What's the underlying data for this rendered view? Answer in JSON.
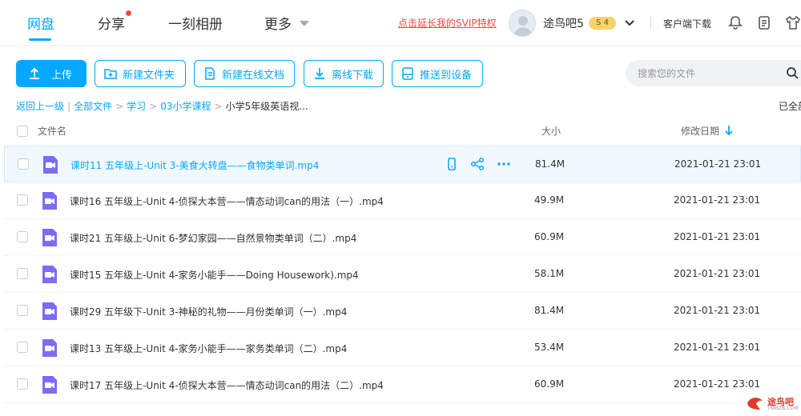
{
  "nav": {
    "tabs": [
      {
        "label": "网盘",
        "active": true
      },
      {
        "label": "分享",
        "has_dot": true
      },
      {
        "label": "一刻相册"
      },
      {
        "label": "更多"
      }
    ]
  },
  "user": {
    "svip_promo": "点击延长我的SVIP特权",
    "name": "途鸟吧5",
    "level_badge": "S 4"
  },
  "header_right": {
    "client_download": "客户端下载"
  },
  "toolbar": {
    "upload": "上传",
    "new_folder": "新建文件夹",
    "new_online_doc": "新建在线文档",
    "offline_download": "离线下载",
    "push_to_device": "推送到设备"
  },
  "search": {
    "placeholder": "搜索您的文件"
  },
  "breadcrumb": {
    "back": "返回上一级",
    "items": [
      "全部文件",
      "学习",
      "03小学课程"
    ],
    "current": "小学5年级英语视...",
    "loaded_status": "已全部加载"
  },
  "table": {
    "headers": {
      "name": "文件名",
      "size": "大小",
      "date": "修改日期"
    },
    "sort": "date-desc",
    "rows": [
      {
        "name": "课时11 五年级上-Unit 3-美食大转盘——食物类单词.mp4",
        "size": "81.4M",
        "date": "2021-01-21 23:01"
      },
      {
        "name": "课时16 五年级上-Unit 4-侦探大本营——情态动词can的用法（一）.mp4",
        "size": "49.9M",
        "date": "2021-01-21 23:01"
      },
      {
        "name": "课时21 五年级上-Unit 6-梦幻家园——自然景物类单词（二）.mp4",
        "size": "60.9M",
        "date": "2021-01-21 23:01"
      },
      {
        "name": "课时15 五年级上-Unit 4-家务小能手——Doing Housework).mp4",
        "size": "58.1M",
        "date": "2021-01-21 23:01"
      },
      {
        "name": "课时29 五年级下-Unit 3-神秘的礼物——月份类单词（一）.mp4",
        "size": "81.4M",
        "date": "2021-01-21 23:01"
      },
      {
        "name": "课时13 五年级上-Unit 4-家务小能手——家务类单词（二）.mp4",
        "size": "53.4M",
        "date": "2021-01-21 23:01"
      },
      {
        "name": "课时17 五年级上-Unit 4-侦探大本营——情态动词can的用法（二）.mp4",
        "size": "60.9M",
        "date": "2021-01-21 23:01"
      }
    ]
  },
  "watermark": {
    "text": "途鸟吧",
    "sub": "TNIBZB.COM"
  },
  "colors": {
    "accent": "#06a7ff",
    "promo": "#f5483b",
    "video_icon": "#7b6cf6"
  }
}
